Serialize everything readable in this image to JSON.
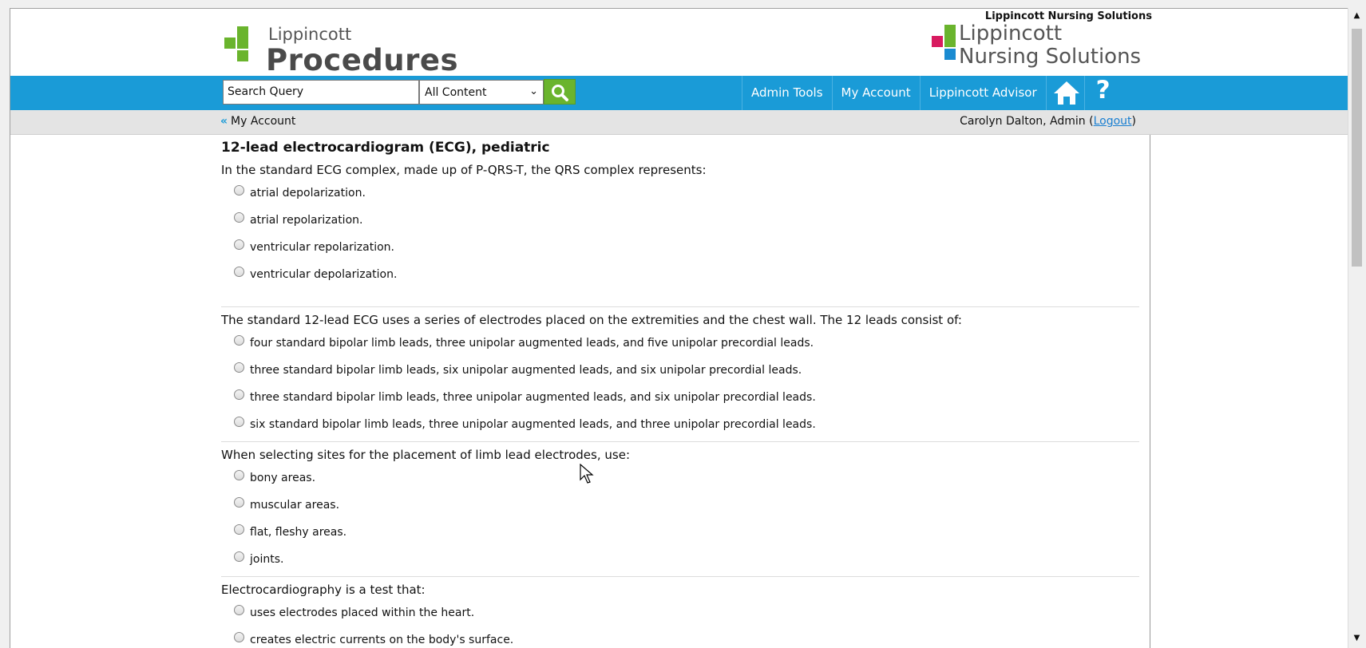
{
  "header": {
    "brand_small": "Lippincott",
    "brand_big": "Procedures",
    "right_tagline": "Lippincott Nursing Solutions",
    "right_name_line1": "Lippincott",
    "right_name_line2": "Nursing Solutions"
  },
  "nav": {
    "search_placeholder": "Search Query",
    "search_value": "Search Query",
    "content_filter": "All Content",
    "links": [
      "Admin Tools",
      "My Account",
      "Lippincott Advisor"
    ],
    "icons": [
      "home-icon",
      "help-icon"
    ]
  },
  "subbar": {
    "back_label": "My Account",
    "user_name": "Carolyn Dalton, Admin (",
    "logout": "Logout",
    "close_paren": ")"
  },
  "page": {
    "title": "12-lead electrocardiogram (ECG), pediatric"
  },
  "questions": [
    {
      "text": "In the standard ECG complex, made up of P-QRS-T, the QRS complex represents:",
      "options": [
        "atrial depolarization.",
        "atrial repolarization.",
        "ventricular repolarization.",
        "ventricular depolarization."
      ]
    },
    {
      "text": "The standard 12-lead ECG uses a series of electrodes placed on the extremities and the chest wall. The 12 leads consist of:",
      "options": [
        "four standard bipolar limb leads, three unipolar augmented leads, and five unipolar precordial leads.",
        "three standard bipolar limb leads, six unipolar augmented leads, and six unipolar precordial leads.",
        "three standard bipolar limb leads, three unipolar augmented leads, and six unipolar precordial leads.",
        "six standard bipolar limb leads, three unipolar augmented leads, and three unipolar precordial leads."
      ]
    },
    {
      "text": "When selecting sites for the placement of limb lead electrodes, use:",
      "options": [
        "bony areas.",
        "muscular areas.",
        "flat, fleshy areas.",
        "joints."
      ]
    },
    {
      "text": "Electrocardiography is a test that:",
      "options": [
        "uses electrodes placed within the heart.",
        "creates electric currents on the body's surface."
      ]
    }
  ],
  "colors": {
    "nav_blue": "#1a9bd7",
    "brand_green": "#6ab42d",
    "brand_pink": "#d81b60",
    "brand_blue": "#1a8bd1"
  }
}
